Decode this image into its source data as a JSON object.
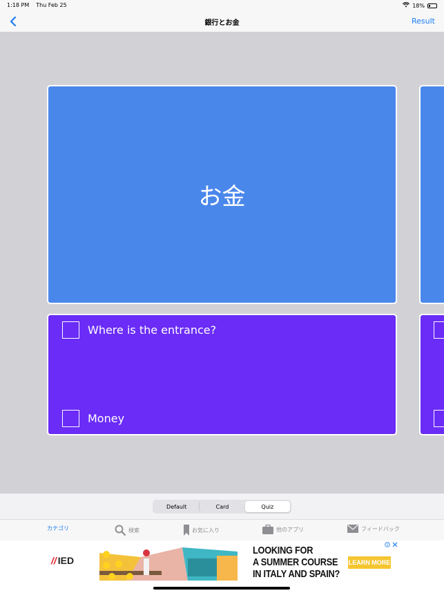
{
  "status_bar": {
    "time": "1:18 PM",
    "date": "Thu Feb 25",
    "battery": "18%"
  },
  "nav": {
    "title": "銀行とお金",
    "result_label": "Result"
  },
  "card": {
    "word": "お金"
  },
  "quiz": {
    "choices": [
      {
        "label": "Where is the entrance?"
      },
      {
        "label": "Money"
      }
    ]
  },
  "segmented": {
    "options": [
      "Default",
      "Card",
      "Quiz"
    ],
    "selected": "Quiz"
  },
  "tab_bar": {
    "tabs": [
      {
        "label": "カテゴリ",
        "icon": "category",
        "active": true
      },
      {
        "label": "検索",
        "icon": "search-icon"
      },
      {
        "label": "お気に入り",
        "icon": "bookmark-icon"
      },
      {
        "label": "他のアプリ",
        "icon": "briefcase-icon"
      },
      {
        "label": "フィードバック",
        "icon": "envelope-icon"
      }
    ]
  },
  "ad": {
    "brand": "IED",
    "headline_line1": "LOOKING FOR",
    "headline_line2": "A SUMMER COURSE",
    "headline_line3": "IN ITALY AND SPAIN?",
    "cta": "LEARN MORE"
  },
  "colors": {
    "accent": "#1a7cf5",
    "card_blue": "#4a87eb",
    "card_purple": "#6a2cf6",
    "background": "#d2d2d6"
  }
}
